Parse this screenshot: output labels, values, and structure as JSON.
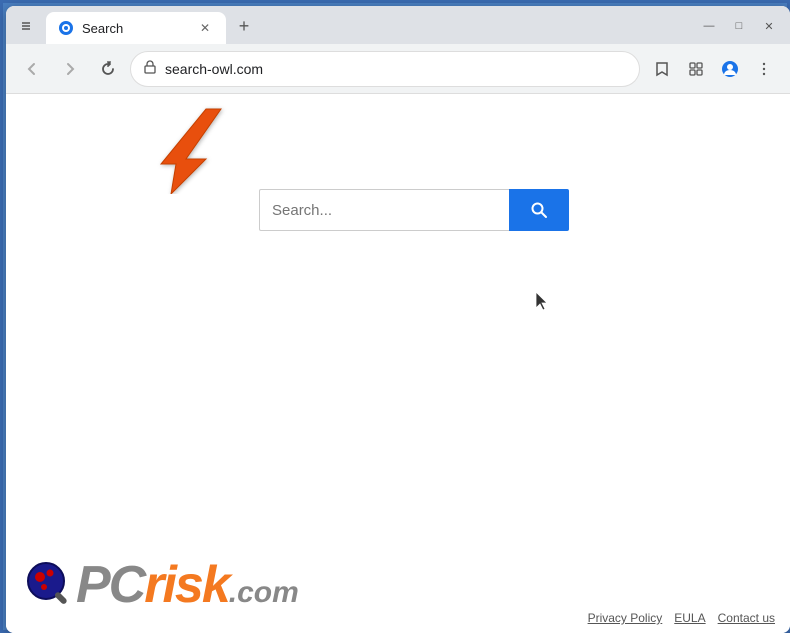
{
  "browser": {
    "tab": {
      "title": "Search",
      "favicon": "🌐"
    },
    "address": "search-owl.com",
    "window_title": "Search"
  },
  "toolbar": {
    "back_label": "←",
    "forward_label": "→",
    "reload_label": "↻",
    "new_tab_label": "+",
    "minimize_label": "—",
    "maximize_label": "□",
    "close_label": "✕",
    "bookmark_label": "☆",
    "extensions_label": "🧩",
    "profile_label": "👤",
    "menu_label": "⋮"
  },
  "search": {
    "placeholder": "Search...",
    "button_label": "🔍"
  },
  "footer": {
    "privacy_label": "Privacy Policy",
    "eula_label": "EULA",
    "contact_label": "Contact us"
  },
  "logo": {
    "pc_text": "PC",
    "risk_text": "risk",
    "domain_text": ".com"
  },
  "annotation": {
    "arrow_color": "#E8500A"
  }
}
